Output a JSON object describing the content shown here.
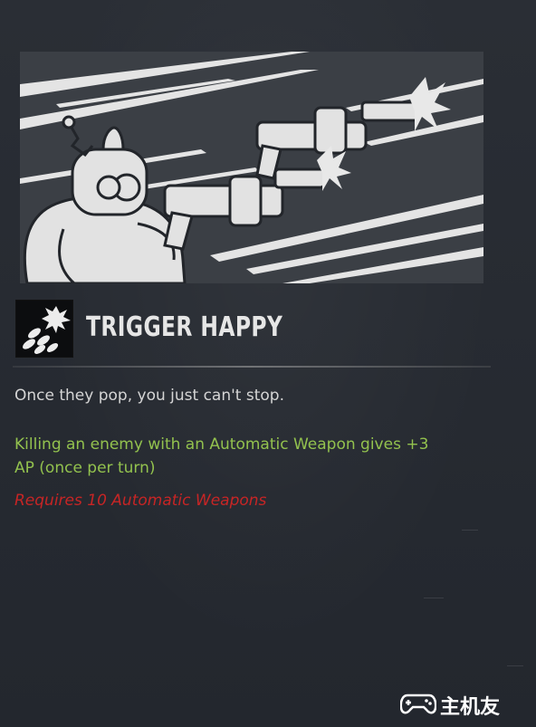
{
  "perk": {
    "title": "TRIGGER HAPPY",
    "flavor_text": "Once they pop, you just can't stop.",
    "effect_text": "Killing an enemy with an Automatic Weapon gives +3 AP (once per turn)",
    "requirement_text": "Requires 10 Automatic Weapons",
    "illustration": "vault-boy-robot-firing-two-automatic-guns",
    "icon": "bullets-burst-icon"
  },
  "watermark": {
    "text": "主机友",
    "logo": "gamepad-logo-icon"
  },
  "colors": {
    "background": "#262a31",
    "title": "#e6e6e6",
    "flavor": "#d5d5d5",
    "effect": "#93c24e",
    "requirement": "#c72525"
  }
}
